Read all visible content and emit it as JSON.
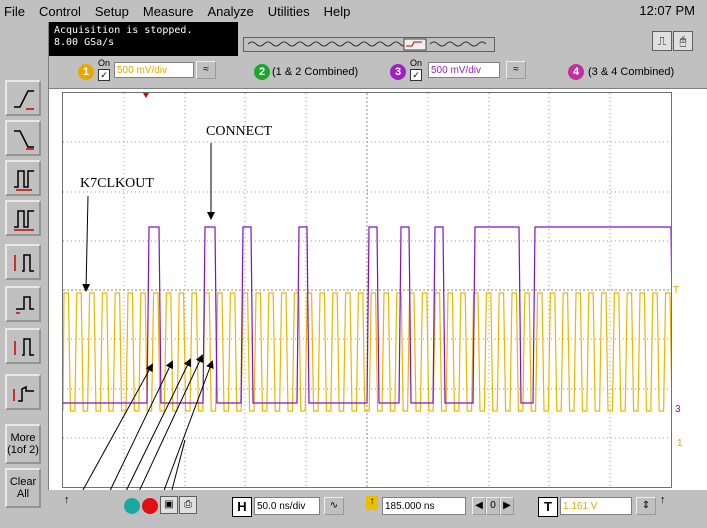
{
  "menu": {
    "items": [
      "File",
      "Control",
      "Setup",
      "Measure",
      "Analyze",
      "Utilities",
      "Help"
    ],
    "clock": "12:07 PM"
  },
  "status": {
    "line1": "Acquisition is stopped.",
    "line2": "8.00 GSa/s"
  },
  "channels": [
    {
      "num": "1",
      "on_label": "On",
      "value": "500 mV/div",
      "color": "#e8a800"
    },
    {
      "num": "2",
      "label": "(1 & 2 Combined)",
      "color": "#19a82a"
    },
    {
      "num": "3",
      "on_label": "On",
      "value": "500 mV/div",
      "color": "#a020c0"
    },
    {
      "num": "4",
      "label": "(3 & 4 Combined)",
      "color": "#c030a0"
    }
  ],
  "toolbar": {
    "more_label": "More (1of 2)",
    "clear_label": "Clear All"
  },
  "bottom": {
    "h_label": "H",
    "timebase": "50.0 ns/div",
    "delay": "185.000 ns",
    "t_label": "T",
    "trigger_level": "1.161 V",
    "zero_label": "0"
  },
  "annotations": {
    "k7": "K7CLKOUT",
    "connect": "CONNECT"
  },
  "markers": {
    "t_marker": "T",
    "ch3_marker": "3",
    "ch1_marker": "1"
  },
  "colors": {
    "yellow_trace": "#f0b400",
    "purple_trace": "#8010c8",
    "panel": "#c0c0c0"
  }
}
